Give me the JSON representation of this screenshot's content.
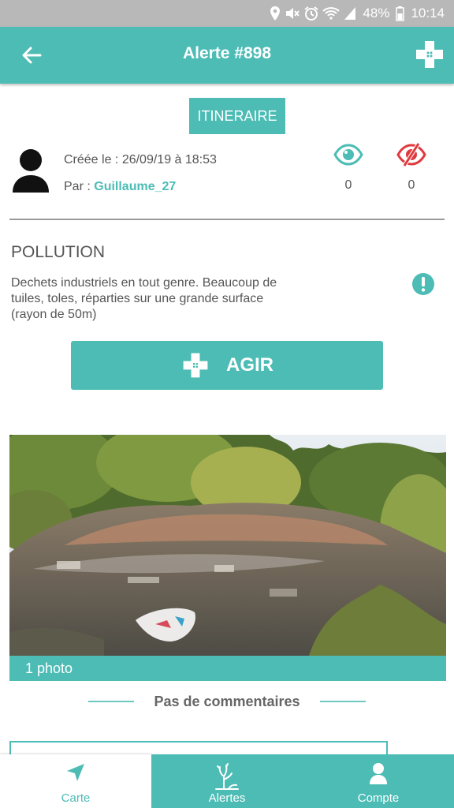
{
  "status_bar": {
    "battery": "48%",
    "time": "10:14",
    "icons": [
      "location-icon",
      "mute-icon",
      "alarm-icon",
      "wifi-icon",
      "signal-icon",
      "battery-icon"
    ]
  },
  "app_bar": {
    "title": "Alerte #898",
    "back_icon": "arrow-left-icon",
    "action_icon": "bandage-icon"
  },
  "itinerary_button": "ITINERAIRE",
  "author": {
    "created_label": "Créée le : 26/09/19 à 18:53",
    "by_label": "Par :",
    "username": "Guillaume_27"
  },
  "views": {
    "seen_count": "0",
    "not_seen_count": "0"
  },
  "alert": {
    "category": "POLLUTION",
    "description": "Dechets industriels en tout genre. Beaucoup de tuiles, toles, réparties sur une grande surface (rayon de 50m)"
  },
  "act_button": "AGIR",
  "photo_caption": "1 photo",
  "comments_label": "Pas de  commentaires",
  "bottom_nav": [
    {
      "label": "Carte",
      "icon": "navigation-arrow-icon",
      "active": true
    },
    {
      "label": "Alertes",
      "icon": "alert-tree-icon",
      "active": false
    },
    {
      "label": "Compte",
      "icon": "user-icon",
      "active": false
    }
  ],
  "colors": {
    "accent": "#4cbcb5",
    "danger": "#e0393e",
    "status_bar": "#b8b8b8"
  }
}
